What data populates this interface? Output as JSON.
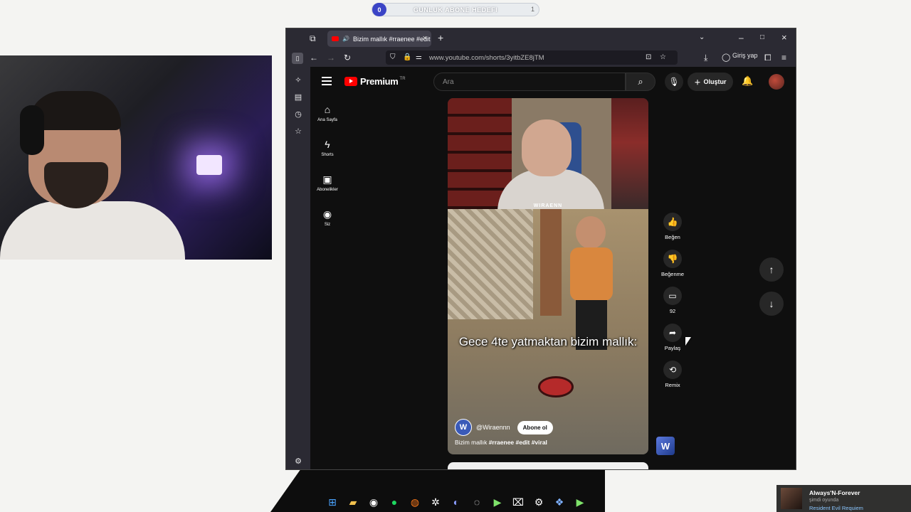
{
  "stream_overlay": {
    "goal_label": "GUNLUK ABONE HEDEFI",
    "goal_current": "0",
    "goal_target": "1"
  },
  "browser": {
    "tab_title": "Bizim mallık #rraenee #edit",
    "url": "www.youtube.com/shorts/3yitbZE8jTM",
    "signin_label": "Giriş yap"
  },
  "youtube": {
    "brand": "Premium",
    "region": "TR",
    "search_placeholder": "Ara",
    "create_label": "Oluştur",
    "guide": [
      {
        "label": "Ana Sayfa",
        "icon": "home-icon"
      },
      {
        "label": "Shorts",
        "icon": "shorts-icon"
      },
      {
        "label": "Abonelikler",
        "icon": "subscriptions-icon"
      },
      {
        "label": "Siz",
        "icon": "you-icon"
      }
    ],
    "short": {
      "watermark": "WIRAENN",
      "overlay_text": "Gece 4te yatmaktan bizim mallık:",
      "channel": "@Wiraennn",
      "subscribe_label": "Abone ol",
      "title_plain": "Bizim mallık ",
      "title_tags": "#rraenee #edit #viral"
    },
    "actions": [
      {
        "label": "Beğen",
        "icon": "like-icon"
      },
      {
        "label": "Beğenme",
        "icon": "dislike-icon"
      },
      {
        "label": "92",
        "icon": "comment-icon"
      },
      {
        "label": "Paylaş",
        "icon": "share-icon"
      },
      {
        "label": "Remix",
        "icon": "remix-icon"
      }
    ]
  },
  "now_playing": {
    "title": "Always'N-Forever",
    "status": "şimdi oyunda",
    "game": "Resident Evil Requiem"
  }
}
